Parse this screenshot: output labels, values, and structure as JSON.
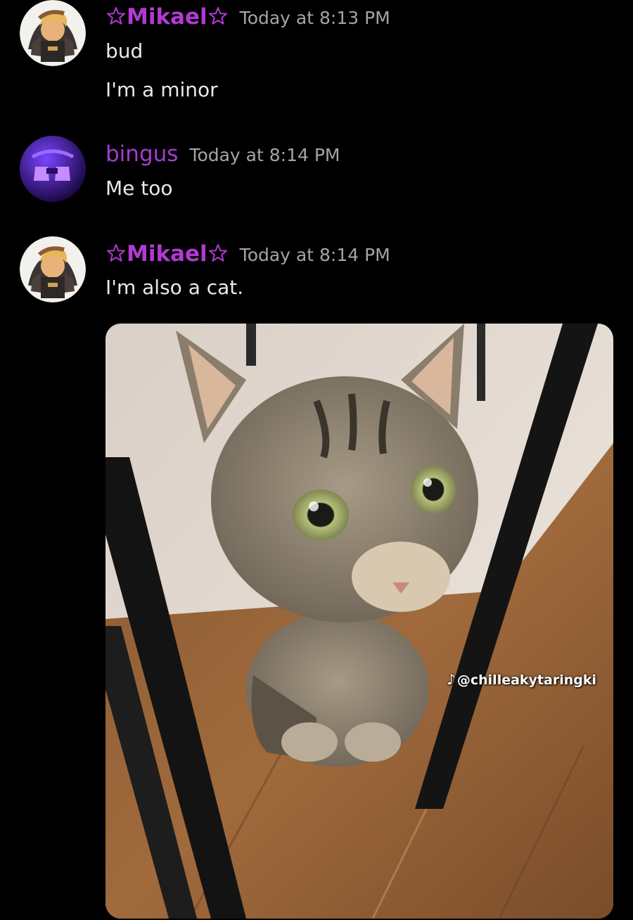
{
  "messages": [
    {
      "username": "Mikael",
      "timestamp": "Today at 8:13 PM",
      "lines": [
        "bud",
        "I'm a minor"
      ]
    },
    {
      "username": "bingus",
      "timestamp": "Today at 8:14 PM",
      "lines": [
        "Me too"
      ]
    },
    {
      "username": "Mikael",
      "timestamp": "Today at 8:14 PM",
      "lines": [
        "I'm also a cat."
      ],
      "attachment": {
        "watermark": "@chilleakytaringki",
        "watermark_icon": "tiktok-icon"
      }
    }
  ],
  "colors": {
    "background": "#000000",
    "mikael_name": "#b13ad1",
    "bingus_name": "#a53ccf",
    "timestamp": "#a3a4ab",
    "message_text": "#e9e9ec"
  },
  "icons": {
    "star": "star-outline-icon"
  }
}
